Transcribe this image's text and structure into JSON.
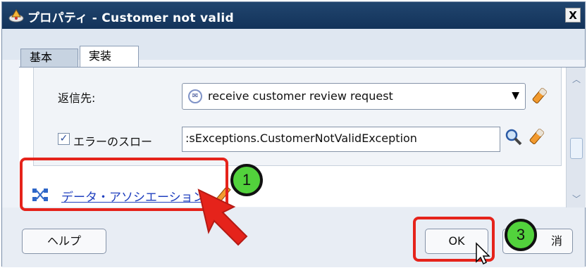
{
  "dialog": {
    "title": "プロパティ - Customer not valid",
    "close_label": "X"
  },
  "tabs": [
    {
      "label": "基本",
      "active": false
    },
    {
      "label": "実装",
      "active": true
    }
  ],
  "form": {
    "reply_to_label": "返信先:",
    "reply_to_value": "receive customer review request",
    "throw_error_label": "エラーのスロー",
    "throw_error_checked": true,
    "throw_error_value": ":sExceptions.CustomerNotValidException"
  },
  "data_association": {
    "link_label": "データ・アソシエーション"
  },
  "buttons": {
    "help": "ヘルプ",
    "ok": "OK",
    "cancel_partial": "消"
  },
  "callouts": {
    "step1": "1",
    "step3": "3"
  },
  "colors": {
    "titlebar": "#1b3c64",
    "highlight": "#e5231b",
    "callout": "#52d23c",
    "link": "#1f3fbf"
  }
}
